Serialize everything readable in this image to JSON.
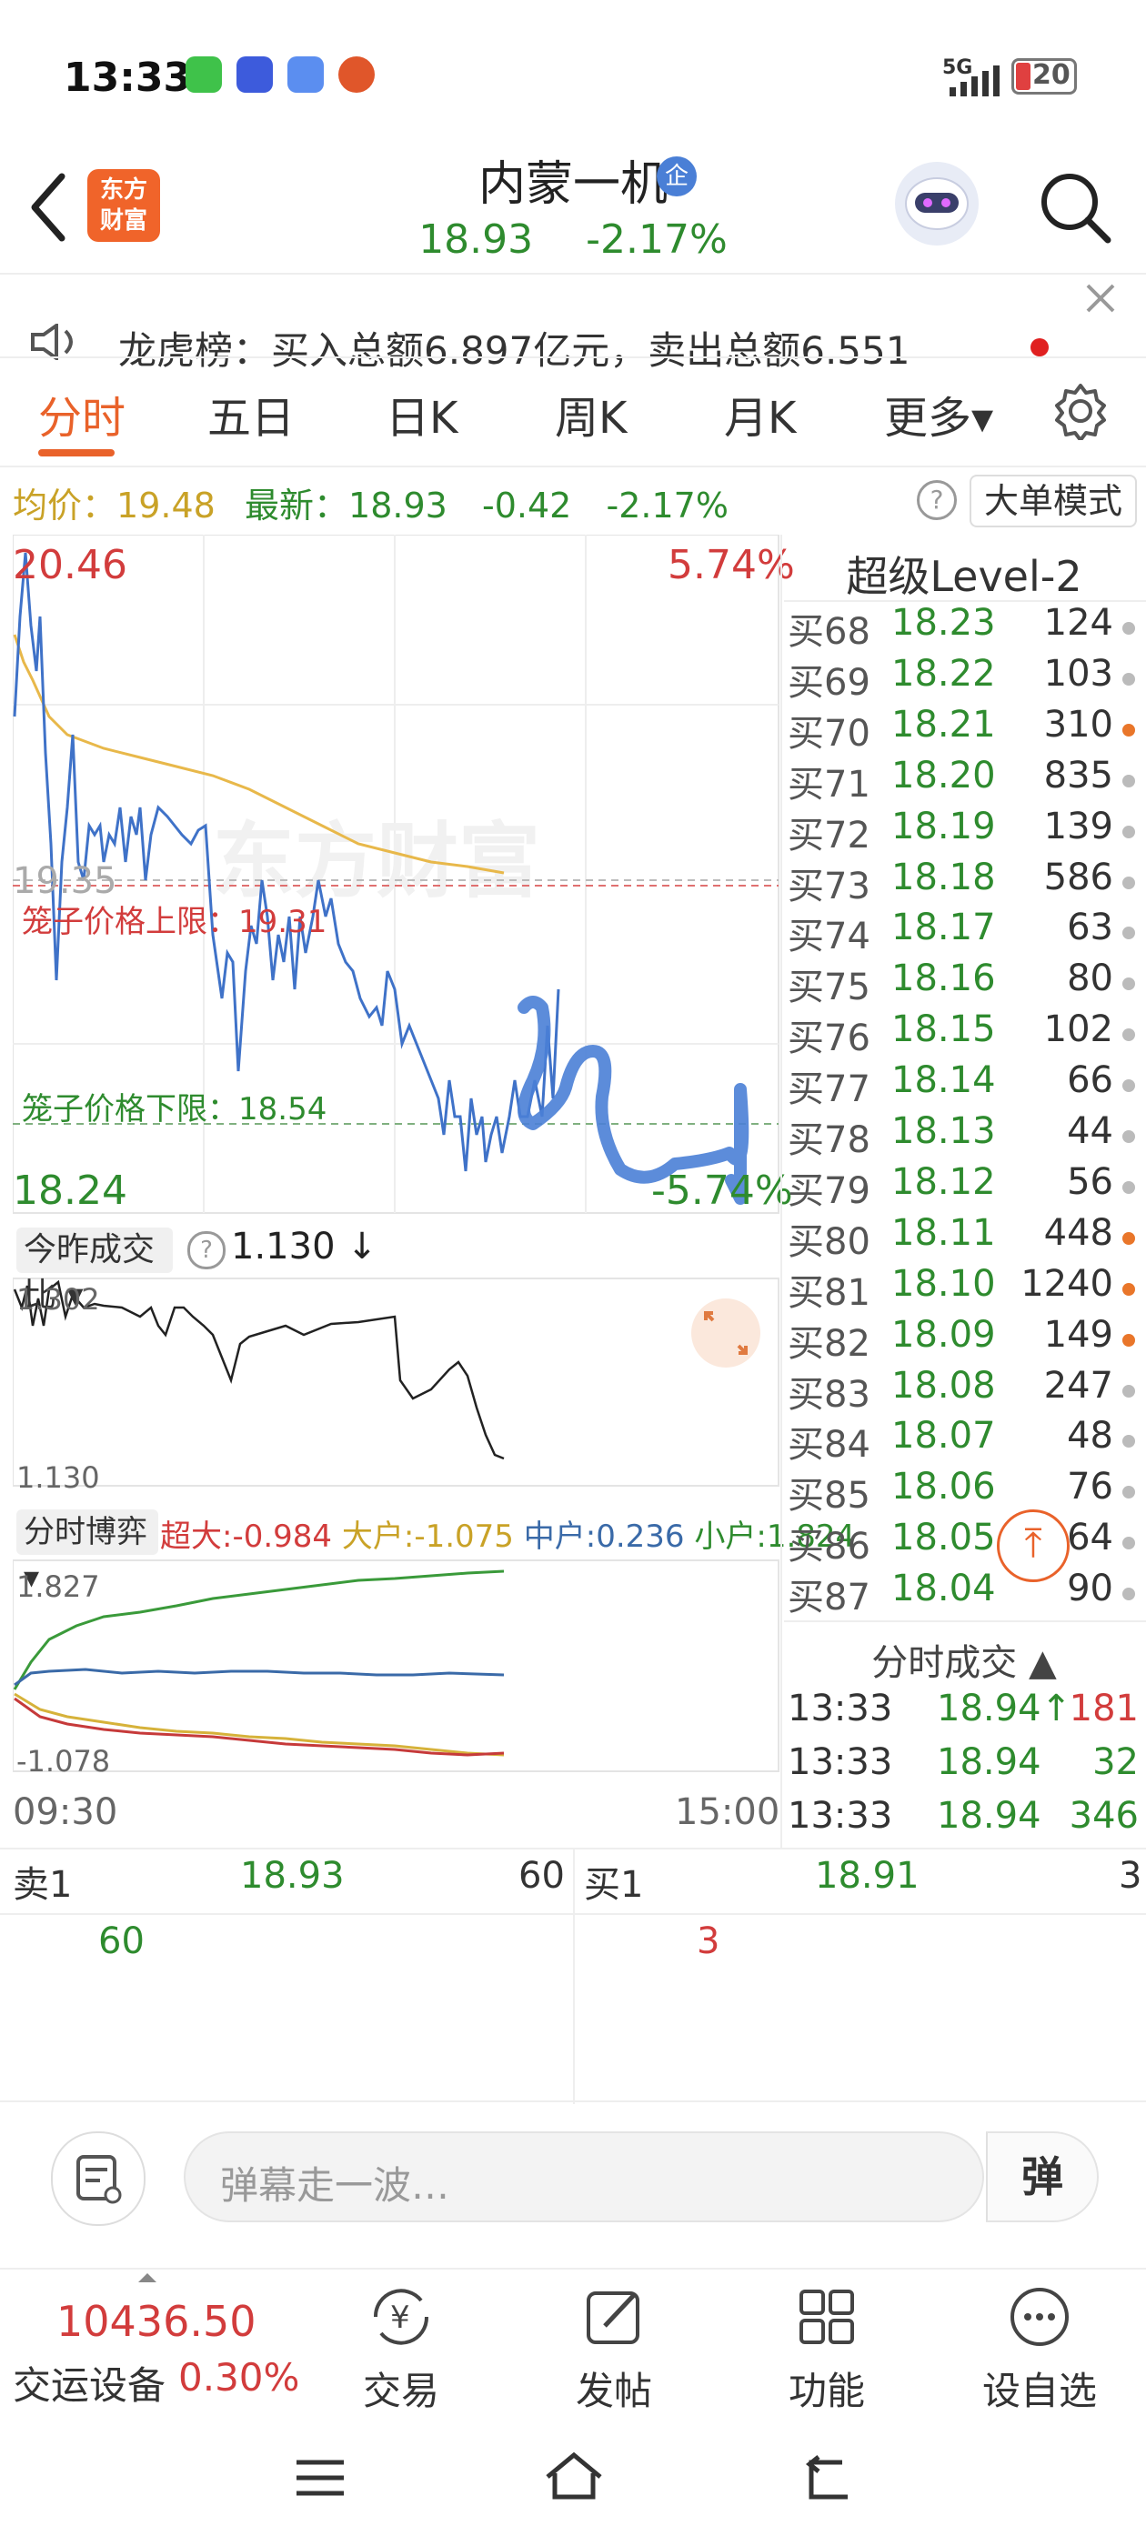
{
  "status_bar": {
    "time": "13:33",
    "network": "5G",
    "battery": "20"
  },
  "header": {
    "logo_line1": "东方",
    "logo_line2": "财富",
    "stock_name": "内蒙一机",
    "badge": "企",
    "price": "18.93",
    "change_pct": "-2.17%"
  },
  "notice": {
    "text": "龙虎榜：买入总额6.897亿元，卖出总额6.551"
  },
  "tabs": [
    {
      "label": "分时"
    },
    {
      "label": "五日"
    },
    {
      "label": "日K"
    },
    {
      "label": "周K"
    },
    {
      "label": "月K"
    },
    {
      "label": "更多▾"
    }
  ],
  "info_row": {
    "avg_label": "均价：",
    "avg_value": "19.48",
    "latest_label": "最新：",
    "latest_value": "18.93",
    "change": "-0.42",
    "change_pct": "-2.17%",
    "big_order_mode": "大单模式"
  },
  "chart": {
    "high_price": "20.46",
    "high_pct": "5.74%",
    "low_price": "18.24",
    "low_pct": "-5.74%",
    "prev_close": "19.35",
    "cage_upper_label": "笼子价格上限：19.31",
    "cage_lower_label": "笼子价格下限：18.54",
    "watermark": "东方财富",
    "accent_blue": "#3f72c8",
    "avg_line_color": "#e8b84a"
  },
  "volume_ratio": {
    "selector": "今昨成交比 ▾",
    "value": "1.130 ↓",
    "top": "1.302",
    "bottom": "1.130"
  },
  "fund_flow": {
    "selector": "分时博弈 ▾",
    "super_large": "超大:-0.984",
    "large": "大户:-1.075",
    "medium": "中户:0.236",
    "small": "小户:1.824",
    "top": "1.827",
    "bottom": "-1.078"
  },
  "time_axis": {
    "start": "09:30",
    "end": "15:00"
  },
  "order_book": {
    "title": "超级Level-2",
    "rows": [
      {
        "label": "买68",
        "price": "18.23",
        "vol": "124",
        "dot": "gray"
      },
      {
        "label": "买69",
        "price": "18.22",
        "vol": "103",
        "dot": "gray"
      },
      {
        "label": "买70",
        "price": "18.21",
        "vol": "310",
        "dot": "orange"
      },
      {
        "label": "买71",
        "price": "18.20",
        "vol": "835",
        "dot": "gray"
      },
      {
        "label": "买72",
        "price": "18.19",
        "vol": "139",
        "dot": "gray"
      },
      {
        "label": "买73",
        "price": "18.18",
        "vol": "586",
        "dot": "gray"
      },
      {
        "label": "买74",
        "price": "18.17",
        "vol": "63",
        "dot": "gray"
      },
      {
        "label": "买75",
        "price": "18.16",
        "vol": "80",
        "dot": "gray"
      },
      {
        "label": "买76",
        "price": "18.15",
        "vol": "102",
        "dot": "gray"
      },
      {
        "label": "买77",
        "price": "18.14",
        "vol": "66",
        "dot": "gray"
      },
      {
        "label": "买78",
        "price": "18.13",
        "vol": "44",
        "dot": "gray"
      },
      {
        "label": "买79",
        "price": "18.12",
        "vol": "56",
        "dot": "gray"
      },
      {
        "label": "买80",
        "price": "18.11",
        "vol": "448",
        "dot": "orange"
      },
      {
        "label": "买81",
        "price": "18.10",
        "vol": "1240",
        "dot": "orange"
      },
      {
        "label": "买82",
        "price": "18.09",
        "vol": "149",
        "dot": "orange"
      },
      {
        "label": "买83",
        "price": "18.08",
        "vol": "247",
        "dot": "gray"
      },
      {
        "label": "买84",
        "price": "18.07",
        "vol": "48",
        "dot": "gray"
      },
      {
        "label": "买85",
        "price": "18.06",
        "vol": "76",
        "dot": "gray"
      },
      {
        "label": "买86",
        "price": "18.05",
        "vol": "64",
        "dot": "gray"
      },
      {
        "label": "买87",
        "price": "18.04",
        "vol": "90",
        "dot": "gray"
      }
    ]
  },
  "trades": {
    "title": "分时成交 ▲",
    "rows": [
      {
        "time": "13:33",
        "price": "18.94↑",
        "vol": "181",
        "vol_color": "red"
      },
      {
        "time": "13:33",
        "price": "18.94",
        "vol": "32",
        "vol_color": "green"
      },
      {
        "time": "13:33",
        "price": "18.94",
        "vol": "346",
        "vol_color": "green"
      }
    ]
  },
  "quote": {
    "ask_label": "卖1",
    "ask_price": "18.93",
    "ask_vol": "60",
    "bid_label": "买1",
    "bid_price": "18.91",
    "bid_vol": "3",
    "ask_vol_big": "60",
    "bid_vol_big": "3"
  },
  "danmaku": {
    "placeholder": "弹幕走一波…",
    "send": "弹"
  },
  "bottom_bar": {
    "index_value": "10436.50",
    "index_name": "交运设备",
    "index_pct": "0.30%",
    "buttons": [
      {
        "label": "交易"
      },
      {
        "label": "发帖"
      },
      {
        "label": "功能"
      },
      {
        "label": "设自选"
      }
    ]
  }
}
